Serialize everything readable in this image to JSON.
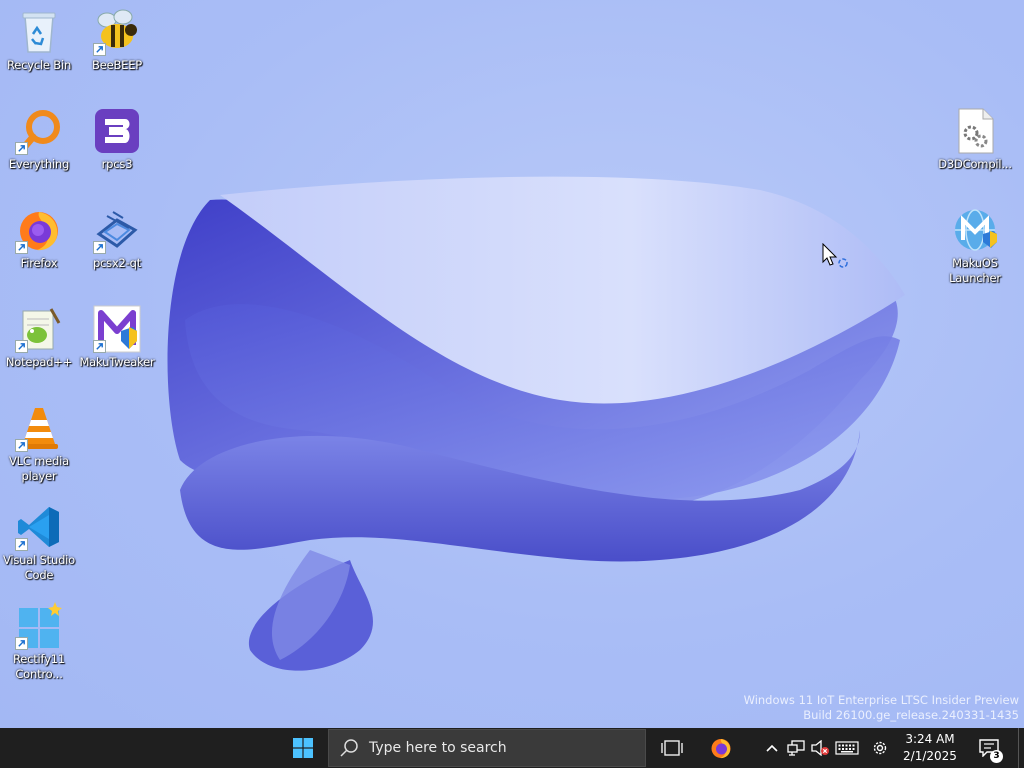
{
  "desktop": {
    "icons": [
      {
        "label": "Recycle Bin",
        "icon": "recycle-bin-icon"
      },
      {
        "label": "BeeBEEP",
        "icon": "bee-icon"
      },
      {
        "label": "Everything",
        "icon": "magnifier-icon"
      },
      {
        "label": "rpcs3",
        "icon": "rpcs3-icon"
      },
      {
        "label": "Firefox",
        "icon": "firefox-icon"
      },
      {
        "label": "pcsx2-qt",
        "icon": "pcsx2-icon"
      },
      {
        "label": "Notepad++",
        "icon": "notepad-plus-plus-icon"
      },
      {
        "label": "MakuTweaker",
        "icon": "makutweaker-icon"
      },
      {
        "label": "VLC media player",
        "icon": "vlc-cone-icon"
      },
      {
        "label": "Visual Studio Code",
        "icon": "vscode-icon"
      },
      {
        "label": "Rectify11 Contro...",
        "icon": "rectify11-icon"
      },
      {
        "label": "D3DCompil...",
        "icon": "settings-file-icon"
      },
      {
        "label": "MakuOS Launcher",
        "icon": "makuos-globe-icon"
      }
    ]
  },
  "watermark": {
    "line1": "Windows 11 IoT Enterprise LTSC Insider Preview",
    "line2": "Build 26100.ge_release.240331-1435"
  },
  "taskbar": {
    "search_placeholder": "Type here to search",
    "clock_time": "3:24 AM",
    "clock_date": "2/1/2025",
    "notification_count": "3"
  },
  "colors": {
    "desktop_bg": "#a8bdf6",
    "taskbar_bg": "#1f1f1f",
    "bloom_dark": "#4b4fd0",
    "bloom_light": "#c9d3fb"
  }
}
